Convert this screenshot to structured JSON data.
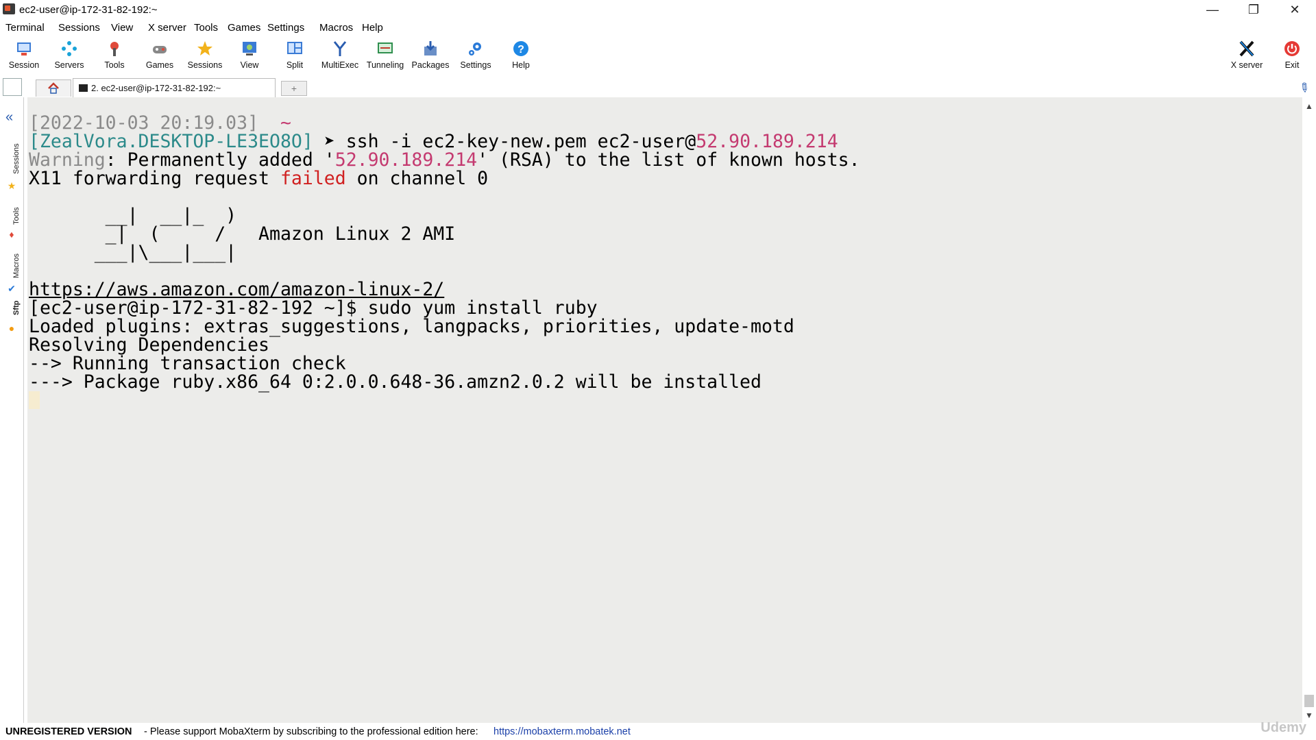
{
  "window": {
    "title": "ec2-user@ip-172-31-82-192:~",
    "controls": {
      "minimize": "—",
      "maximize": "❐",
      "close": "✕"
    }
  },
  "menu": [
    "Terminal",
    "Sessions",
    "View",
    "X server",
    "Tools",
    "Games",
    "Settings",
    "Macros",
    "Help"
  ],
  "toolbar": {
    "left": [
      {
        "label": "Session",
        "icon": "session-icon"
      },
      {
        "label": "Servers",
        "icon": "servers-icon"
      },
      {
        "label": "Tools",
        "icon": "tools-icon"
      },
      {
        "label": "Games",
        "icon": "games-icon"
      },
      {
        "label": "Sessions",
        "icon": "star-icon"
      },
      {
        "label": "View",
        "icon": "view-icon"
      },
      {
        "label": "Split",
        "icon": "split-icon"
      },
      {
        "label": "MultiExec",
        "icon": "multiexec-icon"
      },
      {
        "label": "Tunneling",
        "icon": "tunneling-icon"
      },
      {
        "label": "Packages",
        "icon": "packages-icon"
      },
      {
        "label": "Settings",
        "icon": "gear-icon"
      },
      {
        "label": "Help",
        "icon": "help-icon"
      }
    ],
    "right": [
      {
        "label": "X server",
        "icon": "x-server-icon"
      },
      {
        "label": "Exit",
        "icon": "power-icon"
      }
    ]
  },
  "tabs": {
    "active_label": "2. ec2-user@ip-172-31-82-192:~",
    "add_symbol": "+"
  },
  "sidebar": {
    "labels": [
      "Sessions",
      "Tools",
      "Macros",
      "Sftp"
    ],
    "collapse_symbol": "«"
  },
  "terminal": {
    "line1_date": "[2022-10-03 20:19.03]",
    "line1_tilde": "~",
    "line2_prompt": "[ZealVora.DESKTOP-LE3EO8O]",
    "line2_arrow": "➤",
    "line2_cmd": " ssh -i ec2-key-new.pem ec2-user@",
    "line2_ip": "52.90.189.214",
    "line3_warning": "Warning",
    "line3_a": ": Permanently added '",
    "line3_ip": "52.90.189.214",
    "line3_b": "' (RSA) to the list of known hosts.",
    "line4_a": "X11 forwarding request ",
    "line4_failed": "failed",
    "line4_b": " on channel 0",
    "logo1": "       __|  __|_  )",
    "logo2": "       _|  (     /   Amazon Linux 2 AMI",
    "logo3": "      ___|\\___|___|",
    "url": "https://aws.amazon.com/amazon-linux-2/",
    "cmd_line": "[ec2-user@ip-172-31-82-192 ~]$ sudo yum install ruby",
    "out1": "Loaded plugins: extras_suggestions, langpacks, priorities, update-motd",
    "out2": "Resolving Dependencies",
    "out3": "--> Running transaction check",
    "out4": "---> Package ruby.x86_64 0:2.0.0.648-36.amzn2.0.2 will be installed"
  },
  "status": {
    "version": "UNREGISTERED VERSION",
    "message": "-  Please support MobaXterm by subscribing to the professional edition here:",
    "link": "https://mobaxterm.mobatek.net",
    "watermark": "Udemy"
  }
}
